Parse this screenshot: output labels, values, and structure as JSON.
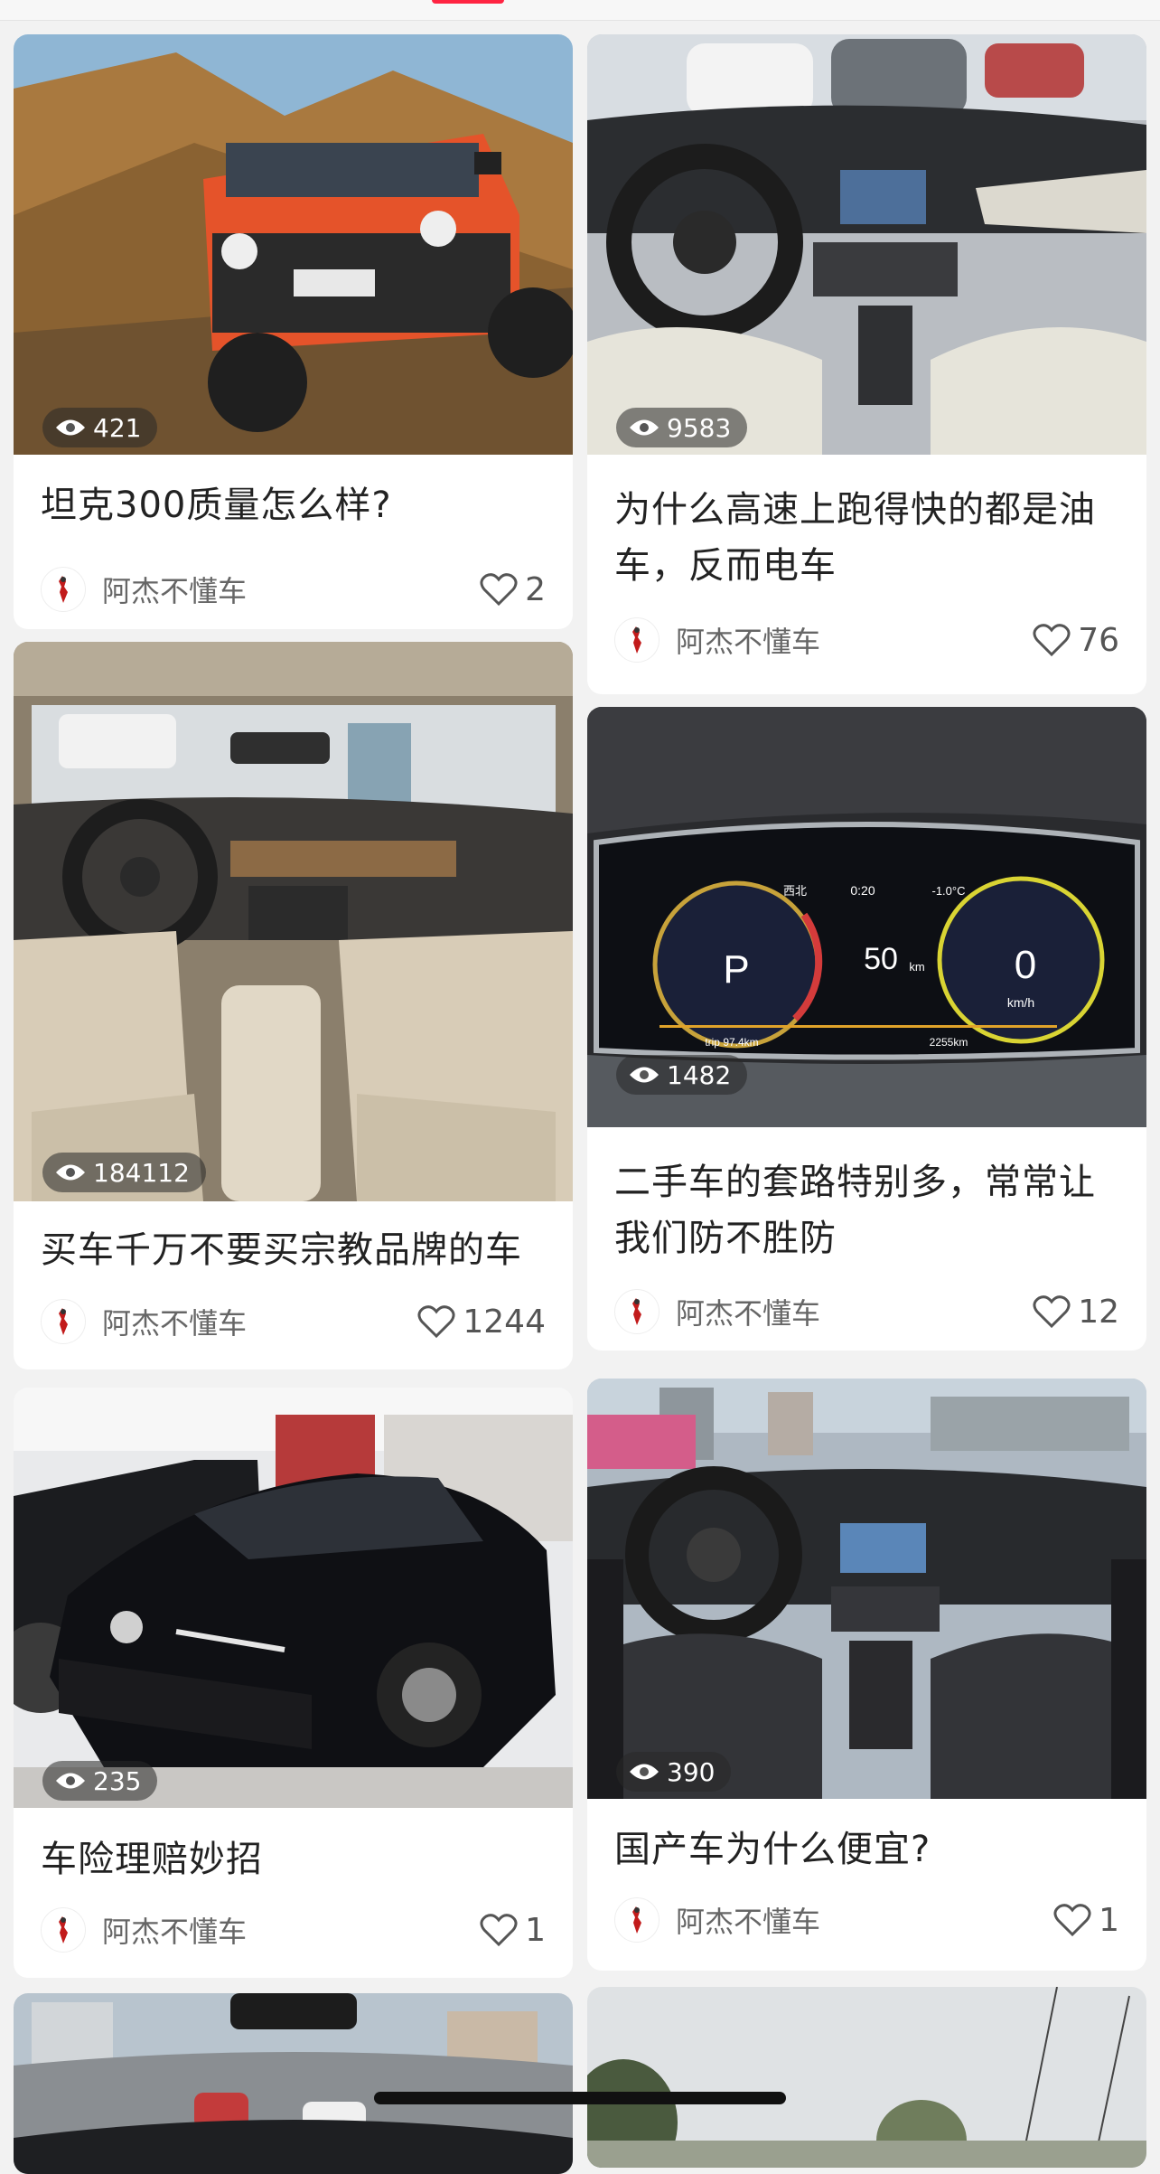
{
  "posts": [
    {
      "title": "坦克300质量怎么样?",
      "views": "421",
      "author": "阿杰不懂车",
      "likes": "2",
      "image": "orange-tank-300-offroad"
    },
    {
      "title": "为什么高速上跑得快的都是油车，反而电车",
      "views": "9583",
      "author": "阿杰不懂车",
      "likes": "76",
      "image": "audi-interior-dashboard"
    },
    {
      "title": "买车千万不要买宗教品牌的车",
      "views": "184112",
      "author": "阿杰不懂车",
      "likes": "1244",
      "image": "bmw-beige-interior"
    },
    {
      "title": "二手车的套路特别多，常常让我们防不胜防",
      "views": "1482",
      "author": "阿杰不懂车",
      "likes": "12",
      "image": "digital-instrument-cluster"
    },
    {
      "title": "车险理赔妙招",
      "views": "235",
      "author": "阿杰不懂车",
      "likes": "1",
      "image": "black-volkswagen-sedan"
    },
    {
      "title": "国产车为什么便宜?",
      "views": "390",
      "author": "阿杰不懂车",
      "likes": "1",
      "image": "changan-black-interior"
    }
  ],
  "cluster": {
    "gear": "P",
    "speed": "0",
    "speed_unit": "km/h",
    "range": "50",
    "range_unit": "km",
    "time": "0:20",
    "heading": "西北",
    "temp": "-1.0°C",
    "trip": "trip 97.4km",
    "odo": "2255km"
  },
  "colors": {
    "accent": "#ff2442",
    "title": "#222222",
    "author": "#666666",
    "background": "#f2f2f2"
  }
}
